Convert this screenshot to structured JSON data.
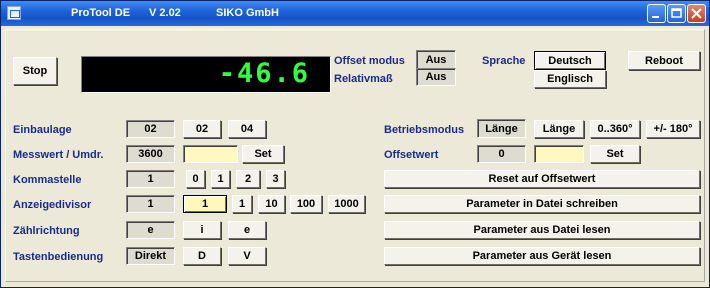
{
  "titlebar": {
    "app_name": "ProTool DE",
    "version": "V 2.02",
    "company": "SIKO GmbH",
    "minimize_icon": "minimize-icon",
    "maximize_icon": "maximize-icon",
    "close_icon": "close-icon"
  },
  "top": {
    "stop_label": "Stop",
    "display_value": "-46.6",
    "offset_modus_label": "Offset modus",
    "offset_modus_value": "Aus",
    "relativmass_label": "Relativmaß",
    "relativmass_value": "Aus",
    "sprache_label": "Sprache",
    "deutsch_label": "Deutsch",
    "englisch_label": "Englisch",
    "reboot_label": "Reboot"
  },
  "left": {
    "einbaulage": {
      "label": "Einbaulage",
      "value": "02",
      "options": [
        "02",
        "04"
      ]
    },
    "messwert": {
      "label": "Messwert / Umdr.",
      "value": "3600",
      "input": "",
      "set_label": "Set"
    },
    "kommastelle": {
      "label": "Kommastelle",
      "value": "1",
      "options": [
        "0",
        "1",
        "2",
        "3"
      ]
    },
    "anzeigedivisor": {
      "label": "Anzeigedivisor",
      "value": "1",
      "options": [
        "1",
        "1",
        "10",
        "100",
        "1000"
      ]
    },
    "zaehlrichtung": {
      "label": "Zählrichtung",
      "value": "e",
      "options": [
        "i",
        "e"
      ]
    },
    "tastenbedienung": {
      "label": "Tastenbedienung",
      "value": "Direkt",
      "options": [
        "D",
        "V"
      ]
    }
  },
  "right": {
    "betriebsmodus": {
      "label": "Betriebsmodus",
      "value": "Länge",
      "options": [
        "Länge",
        "0..360°",
        "+/- 180°"
      ]
    },
    "offsetwert": {
      "label": "Offsetwert",
      "value": "0",
      "input": "",
      "set_label": "Set"
    },
    "reset_label": "Reset auf Offsetwert",
    "save_file_label": "Parameter in Datei schreiben",
    "load_file_label": "Parameter aus Datei lesen",
    "load_device_label": "Parameter aus Gerät lesen"
  },
  "colors": {
    "titlebar": "#1f62d9",
    "label_blue": "#1a2b8c",
    "display_bg": "#000000",
    "display_fg": "#30ff40",
    "highlight_yellow": "#fff8b8"
  }
}
